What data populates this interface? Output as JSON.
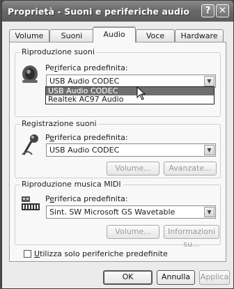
{
  "window": {
    "title": "Proprietà - Suoni e periferiche audio",
    "help_label": "?",
    "close_label": "✕"
  },
  "tabs": [
    {
      "label": "Volume"
    },
    {
      "label": "Suoni"
    },
    {
      "label": "Audio"
    },
    {
      "label": "Voce"
    },
    {
      "label": "Hardware"
    }
  ],
  "playback": {
    "group_label": "Riproduzione suoni",
    "field_label_pre": "Pe",
    "field_label_u": "r",
    "field_label_post": "iferica predefinita:",
    "selected": "USB Audio CODEC",
    "options": [
      "USB Audio CODEC",
      "Realtek AC97 Audio"
    ]
  },
  "recording": {
    "group_label": "Registrazione suoni",
    "field_label_pre": "P",
    "field_label_u": "e",
    "field_label_post": "riferica predefinita:",
    "selected": "USB Audio CODEC",
    "volume_label": "Volume...",
    "advanced_label": "Avanzate..."
  },
  "midi": {
    "group_label": "Riproduzione musica MIDI",
    "field_label_pre": "P",
    "field_label_u": "e",
    "field_label_post": "riferica predefinita:",
    "selected": "Sint. SW Microsoft GS Wavetable",
    "volume_label": "Volume...",
    "info_label": "Informazioni su..."
  },
  "checkbox_label_u": "U",
  "checkbox_label_post": "tilizza solo periferiche predefinite",
  "buttons": {
    "ok": "OK",
    "cancel": "Annulla",
    "apply": "Applica"
  }
}
